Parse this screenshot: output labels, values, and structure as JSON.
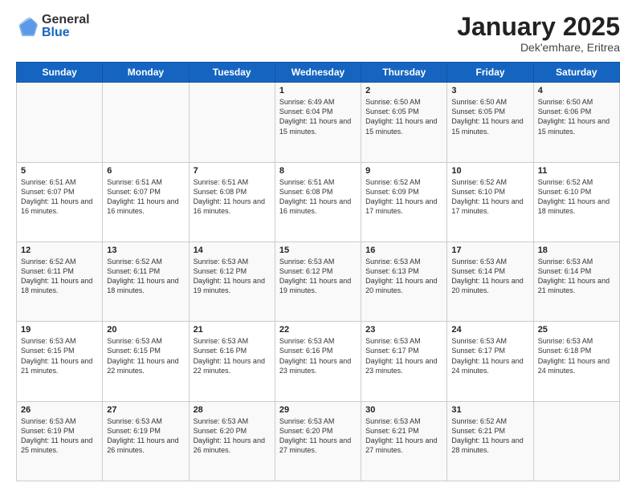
{
  "header": {
    "logo_line1": "General",
    "logo_line2": "Blue",
    "month": "January 2025",
    "location": "Dek'emhare, Eritrea"
  },
  "weekdays": [
    "Sunday",
    "Monday",
    "Tuesday",
    "Wednesday",
    "Thursday",
    "Friday",
    "Saturday"
  ],
  "weeks": [
    [
      {
        "day": "",
        "text": ""
      },
      {
        "day": "",
        "text": ""
      },
      {
        "day": "",
        "text": ""
      },
      {
        "day": "1",
        "text": "Sunrise: 6:49 AM\nSunset: 6:04 PM\nDaylight: 11 hours and 15 minutes."
      },
      {
        "day": "2",
        "text": "Sunrise: 6:50 AM\nSunset: 6:05 PM\nDaylight: 11 hours and 15 minutes."
      },
      {
        "day": "3",
        "text": "Sunrise: 6:50 AM\nSunset: 6:05 PM\nDaylight: 11 hours and 15 minutes."
      },
      {
        "day": "4",
        "text": "Sunrise: 6:50 AM\nSunset: 6:06 PM\nDaylight: 11 hours and 15 minutes."
      }
    ],
    [
      {
        "day": "5",
        "text": "Sunrise: 6:51 AM\nSunset: 6:07 PM\nDaylight: 11 hours and 16 minutes."
      },
      {
        "day": "6",
        "text": "Sunrise: 6:51 AM\nSunset: 6:07 PM\nDaylight: 11 hours and 16 minutes."
      },
      {
        "day": "7",
        "text": "Sunrise: 6:51 AM\nSunset: 6:08 PM\nDaylight: 11 hours and 16 minutes."
      },
      {
        "day": "8",
        "text": "Sunrise: 6:51 AM\nSunset: 6:08 PM\nDaylight: 11 hours and 16 minutes."
      },
      {
        "day": "9",
        "text": "Sunrise: 6:52 AM\nSunset: 6:09 PM\nDaylight: 11 hours and 17 minutes."
      },
      {
        "day": "10",
        "text": "Sunrise: 6:52 AM\nSunset: 6:10 PM\nDaylight: 11 hours and 17 minutes."
      },
      {
        "day": "11",
        "text": "Sunrise: 6:52 AM\nSunset: 6:10 PM\nDaylight: 11 hours and 18 minutes."
      }
    ],
    [
      {
        "day": "12",
        "text": "Sunrise: 6:52 AM\nSunset: 6:11 PM\nDaylight: 11 hours and 18 minutes."
      },
      {
        "day": "13",
        "text": "Sunrise: 6:52 AM\nSunset: 6:11 PM\nDaylight: 11 hours and 18 minutes."
      },
      {
        "day": "14",
        "text": "Sunrise: 6:53 AM\nSunset: 6:12 PM\nDaylight: 11 hours and 19 minutes."
      },
      {
        "day": "15",
        "text": "Sunrise: 6:53 AM\nSunset: 6:12 PM\nDaylight: 11 hours and 19 minutes."
      },
      {
        "day": "16",
        "text": "Sunrise: 6:53 AM\nSunset: 6:13 PM\nDaylight: 11 hours and 20 minutes."
      },
      {
        "day": "17",
        "text": "Sunrise: 6:53 AM\nSunset: 6:14 PM\nDaylight: 11 hours and 20 minutes."
      },
      {
        "day": "18",
        "text": "Sunrise: 6:53 AM\nSunset: 6:14 PM\nDaylight: 11 hours and 21 minutes."
      }
    ],
    [
      {
        "day": "19",
        "text": "Sunrise: 6:53 AM\nSunset: 6:15 PM\nDaylight: 11 hours and 21 minutes."
      },
      {
        "day": "20",
        "text": "Sunrise: 6:53 AM\nSunset: 6:15 PM\nDaylight: 11 hours and 22 minutes."
      },
      {
        "day": "21",
        "text": "Sunrise: 6:53 AM\nSunset: 6:16 PM\nDaylight: 11 hours and 22 minutes."
      },
      {
        "day": "22",
        "text": "Sunrise: 6:53 AM\nSunset: 6:16 PM\nDaylight: 11 hours and 23 minutes."
      },
      {
        "day": "23",
        "text": "Sunrise: 6:53 AM\nSunset: 6:17 PM\nDaylight: 11 hours and 23 minutes."
      },
      {
        "day": "24",
        "text": "Sunrise: 6:53 AM\nSunset: 6:17 PM\nDaylight: 11 hours and 24 minutes."
      },
      {
        "day": "25",
        "text": "Sunrise: 6:53 AM\nSunset: 6:18 PM\nDaylight: 11 hours and 24 minutes."
      }
    ],
    [
      {
        "day": "26",
        "text": "Sunrise: 6:53 AM\nSunset: 6:19 PM\nDaylight: 11 hours and 25 minutes."
      },
      {
        "day": "27",
        "text": "Sunrise: 6:53 AM\nSunset: 6:19 PM\nDaylight: 11 hours and 26 minutes."
      },
      {
        "day": "28",
        "text": "Sunrise: 6:53 AM\nSunset: 6:20 PM\nDaylight: 11 hours and 26 minutes."
      },
      {
        "day": "29",
        "text": "Sunrise: 6:53 AM\nSunset: 6:20 PM\nDaylight: 11 hours and 27 minutes."
      },
      {
        "day": "30",
        "text": "Sunrise: 6:53 AM\nSunset: 6:21 PM\nDaylight: 11 hours and 27 minutes."
      },
      {
        "day": "31",
        "text": "Sunrise: 6:52 AM\nSunset: 6:21 PM\nDaylight: 11 hours and 28 minutes."
      },
      {
        "day": "",
        "text": ""
      }
    ]
  ]
}
